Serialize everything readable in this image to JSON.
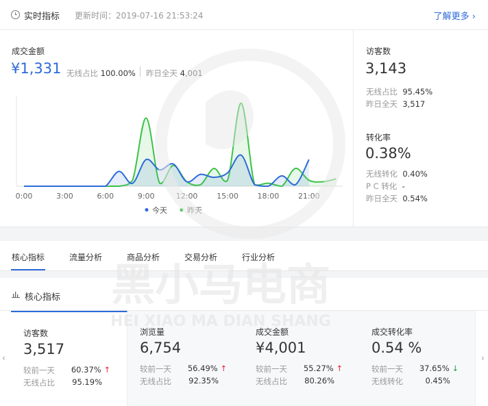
{
  "header": {
    "title": "实时指标",
    "updated": "更新时间：2019-07-16 21:53:24",
    "more": "了解更多 ›"
  },
  "gmv": {
    "label": "成交金额",
    "value": "¥1,331",
    "wireless_label": "无线占比",
    "wireless_value": "100.00%",
    "yesterday_label": "昨日全天",
    "yesterday_value": "4,001"
  },
  "visitors": {
    "label": "访客数",
    "value": "3,143",
    "wireless_label": "无线占比",
    "wireless_value": "95.45%",
    "yesterday_label": "昨日全天",
    "yesterday_value": "3,517"
  },
  "conversion": {
    "label": "转化率",
    "value": "0.38%",
    "wireless_label": "无线转化",
    "wireless_value": "0.40%",
    "pc_label": "P C 转化",
    "pc_value": "-",
    "yesterday_label": "昨日全天",
    "yesterday_value": "0.54%"
  },
  "chart_data": {
    "type": "line",
    "x": [
      0,
      1,
      2,
      3,
      4,
      5,
      6,
      7,
      8,
      9,
      10,
      11,
      12,
      13,
      14,
      15,
      16,
      17,
      18,
      19,
      20,
      21,
      22,
      23
    ],
    "x_ticks": [
      "0:00",
      "3:00",
      "6:00",
      "9:00",
      "12:00",
      "15:00",
      "18:00",
      "21:00"
    ],
    "x_tick_values": [
      0,
      3,
      6,
      9,
      12,
      15,
      18,
      21
    ],
    "series": [
      {
        "name": "今天",
        "color": "#2c6ad9",
        "values": [
          0,
          0,
          0,
          0,
          0,
          0,
          0,
          50,
          10,
          90,
          55,
          75,
          15,
          40,
          30,
          45,
          105,
          5,
          0,
          35,
          5,
          90
        ]
      },
      {
        "name": "昨天",
        "color": "#3cc24b",
        "values": [
          0,
          0,
          0,
          0,
          0,
          0,
          0,
          0,
          20,
          230,
          10,
          70,
          15,
          5,
          60,
          20,
          280,
          5,
          10,
          0,
          60,
          20,
          15,
          25
        ]
      }
    ],
    "ylim": [
      0,
      300
    ],
    "grid": false,
    "legend_position": "bottom"
  },
  "tabs": [
    "核心指标",
    "流量分析",
    "商品分析",
    "交易分析",
    "行业分析"
  ],
  "core": {
    "title": "核心指标",
    "cards": [
      {
        "title": "访客数",
        "value": "3,517",
        "r1_label": "较前一天",
        "r1_value": "60.37%",
        "r1_trend": "↑",
        "r2_label": "无线占比",
        "r2_value": "95.19%"
      },
      {
        "title": "浏览量",
        "value": "6,754",
        "r1_label": "较前一天",
        "r1_value": "56.49%",
        "r1_trend": "↑",
        "r2_label": "无线占比",
        "r2_value": "92.35%"
      },
      {
        "title": "成交金额",
        "value": "¥4,001",
        "r1_label": "较前一天",
        "r1_value": "55.27%",
        "r1_trend": "↑",
        "r2_label": "无线占比",
        "r2_value": "80.26%"
      },
      {
        "title": "成交转化率",
        "value": "0.54 %",
        "r1_label": "较前一天",
        "r1_value": "37.65%",
        "r1_trend": "↓",
        "r2_label": "无线转化",
        "r2_value": "0.45%"
      }
    ],
    "prev": "‹",
    "next": "›"
  },
  "watermark": {
    "cn": "黑小马电商",
    "en": "HEI XIAO MA DIAN SHANG"
  }
}
